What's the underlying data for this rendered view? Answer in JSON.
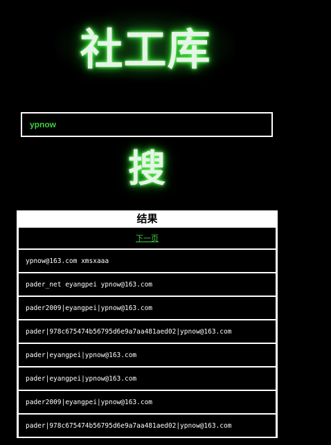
{
  "logo": {
    "text": "社工库"
  },
  "search": {
    "value": "ypnow"
  },
  "search_button": {
    "label": "搜"
  },
  "results": {
    "title": "结果",
    "next_page": "下一页",
    "rows": [
      "ypnow@163.com xmsxaaa",
      "pader_net eyangpei ypnow@163.com",
      "pader2009|eyangpei|ypnow@163.com",
      "pader|978c675474b56795d6e9a7aa481aed02|ypnow@163.com",
      "pader|eyangpei|ypnow@163.com",
      "pader|eyangpei|ypnow@163.com",
      "pader2009|eyangpei|ypnow@163.com",
      "pader|978c675474b56795d6e9a7aa481aed02|ypnow@163.com"
    ]
  },
  "colors": {
    "background": "#000000",
    "glow": "#2ee62e",
    "input_text": "#3fd13f",
    "link": "#3fd13f"
  }
}
